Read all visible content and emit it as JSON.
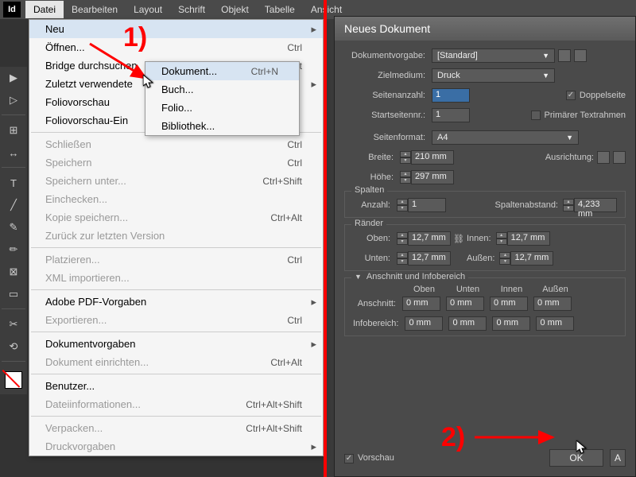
{
  "app_icon": "Id",
  "menubar": [
    "Datei",
    "Bearbeiten",
    "Layout",
    "Schrift",
    "Objekt",
    "Tabelle",
    "Ansicht"
  ],
  "file_menu": {
    "neu": "Neu",
    "open": "Öffnen...",
    "open_sc": "Ctrl",
    "bridge": "Bridge durchsuchen",
    "bridge_sc": "Alt",
    "recent": "Zuletzt verwendete",
    "folioPrev": "Foliovorschau",
    "folioPrevCfg": "Foliovorschau-Ein",
    "close": "Schließen",
    "close_sc": "Ctrl",
    "save": "Speichern",
    "save_sc": "Ctrl",
    "saveAs": "Speichern unter...",
    "saveAs_sc": "Ctrl+Shift",
    "checkin": "Einchecken...",
    "saveCopy": "Kopie speichern...",
    "saveCopy_sc": "Ctrl+Alt",
    "revert": "Zurück zur letzten Version",
    "place": "Platzieren...",
    "place_sc": "Ctrl",
    "importXML": "XML importieren...",
    "pdfPresets": "Adobe PDF-Vorgaben",
    "export": "Exportieren...",
    "export_sc": "Ctrl",
    "docPresets": "Dokumentvorgaben",
    "docSetup": "Dokument einrichten...",
    "docSetup_sc": "Ctrl+Alt",
    "user": "Benutzer...",
    "fileInfo": "Dateiinformationen...",
    "fileInfo_sc": "Ctrl+Alt+Shift",
    "package": "Verpacken...",
    "package_sc": "Ctrl+Alt+Shift",
    "printPresets": "Druckvorgaben"
  },
  "submenu": {
    "doc": "Dokument...",
    "doc_sc": "Ctrl+N",
    "book": "Buch...",
    "folio": "Folio...",
    "lib": "Bibliothek..."
  },
  "dialog": {
    "title": "Neues Dokument",
    "preset_lbl": "Dokumentvorgabe:",
    "preset_val": "[Standard]",
    "intent_lbl": "Zielmedium:",
    "intent_val": "Druck",
    "pages_lbl": "Seitenanzahl:",
    "pages_val": "1",
    "facing_lbl": "Doppelseite",
    "startpage_lbl": "Startseitennr.:",
    "startpage_val": "1",
    "primary_lbl": "Primärer Textrahmen",
    "pagesize_lbl": "Seitenformat:",
    "pagesize_val": "A4",
    "width_lbl": "Breite:",
    "width_val": "210 mm",
    "height_lbl": "Höhe:",
    "height_val": "297 mm",
    "orient_lbl": "Ausrichtung:",
    "columns_legend": "Spalten",
    "colcount_lbl": "Anzahl:",
    "colcount_val": "1",
    "gutter_lbl": "Spaltenabstand:",
    "gutter_val": "4,233 mm",
    "margins_legend": "Ränder",
    "top_lbl": "Oben:",
    "top_val": "12,7 mm",
    "bottom_lbl": "Unten:",
    "bottom_val": "12,7 mm",
    "inside_lbl": "Innen:",
    "inside_val": "12,7 mm",
    "outside_lbl": "Außen:",
    "outside_val": "12,7 mm",
    "bleed_legend": "Anschnitt und Infobereich",
    "h_top": "Oben",
    "h_bottom": "Unten",
    "h_in": "Innen",
    "h_out": "Außen",
    "bleed_lbl": "Anschnitt:",
    "bleed_val": "0 mm",
    "slug_lbl": "Infobereich:",
    "slug_val": "0 mm",
    "preview_lbl": "Vorschau",
    "ok": "OK",
    "cancel": "A"
  },
  "anno": {
    "one": "1)",
    "two": "2)"
  }
}
